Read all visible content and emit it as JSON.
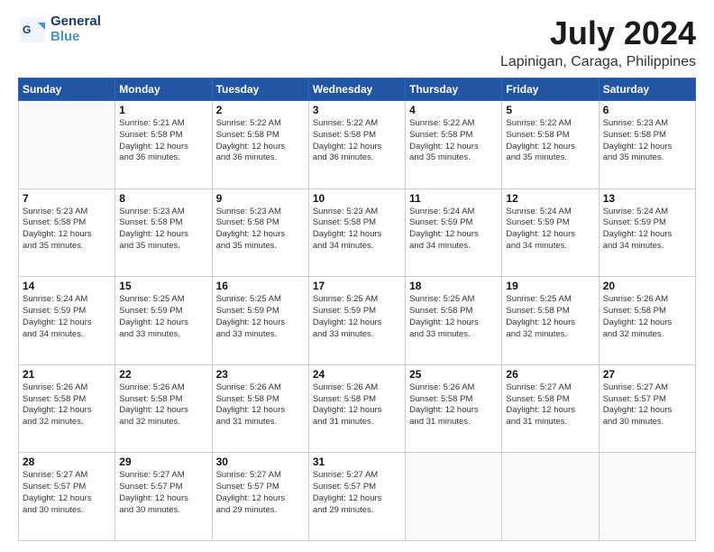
{
  "logo": {
    "line1": "General",
    "line2": "Blue"
  },
  "title": "July 2024",
  "subtitle": "Lapinigan, Caraga, Philippines",
  "days_of_week": [
    "Sunday",
    "Monday",
    "Tuesday",
    "Wednesday",
    "Thursday",
    "Friday",
    "Saturday"
  ],
  "weeks": [
    [
      {
        "num": "",
        "info": ""
      },
      {
        "num": "1",
        "info": "Sunrise: 5:21 AM\nSunset: 5:58 PM\nDaylight: 12 hours\nand 36 minutes."
      },
      {
        "num": "2",
        "info": "Sunrise: 5:22 AM\nSunset: 5:58 PM\nDaylight: 12 hours\nand 36 minutes."
      },
      {
        "num": "3",
        "info": "Sunrise: 5:22 AM\nSunset: 5:58 PM\nDaylight: 12 hours\nand 36 minutes."
      },
      {
        "num": "4",
        "info": "Sunrise: 5:22 AM\nSunset: 5:58 PM\nDaylight: 12 hours\nand 35 minutes."
      },
      {
        "num": "5",
        "info": "Sunrise: 5:22 AM\nSunset: 5:58 PM\nDaylight: 12 hours\nand 35 minutes."
      },
      {
        "num": "6",
        "info": "Sunrise: 5:23 AM\nSunset: 5:58 PM\nDaylight: 12 hours\nand 35 minutes."
      }
    ],
    [
      {
        "num": "7",
        "info": "Sunrise: 5:23 AM\nSunset: 5:58 PM\nDaylight: 12 hours\nand 35 minutes."
      },
      {
        "num": "8",
        "info": "Sunrise: 5:23 AM\nSunset: 5:58 PM\nDaylight: 12 hours\nand 35 minutes."
      },
      {
        "num": "9",
        "info": "Sunrise: 5:23 AM\nSunset: 5:58 PM\nDaylight: 12 hours\nand 35 minutes."
      },
      {
        "num": "10",
        "info": "Sunrise: 5:23 AM\nSunset: 5:58 PM\nDaylight: 12 hours\nand 34 minutes."
      },
      {
        "num": "11",
        "info": "Sunrise: 5:24 AM\nSunset: 5:59 PM\nDaylight: 12 hours\nand 34 minutes."
      },
      {
        "num": "12",
        "info": "Sunrise: 5:24 AM\nSunset: 5:59 PM\nDaylight: 12 hours\nand 34 minutes."
      },
      {
        "num": "13",
        "info": "Sunrise: 5:24 AM\nSunset: 5:59 PM\nDaylight: 12 hours\nand 34 minutes."
      }
    ],
    [
      {
        "num": "14",
        "info": "Sunrise: 5:24 AM\nSunset: 5:59 PM\nDaylight: 12 hours\nand 34 minutes."
      },
      {
        "num": "15",
        "info": "Sunrise: 5:25 AM\nSunset: 5:59 PM\nDaylight: 12 hours\nand 33 minutes."
      },
      {
        "num": "16",
        "info": "Sunrise: 5:25 AM\nSunset: 5:59 PM\nDaylight: 12 hours\nand 33 minutes."
      },
      {
        "num": "17",
        "info": "Sunrise: 5:25 AM\nSunset: 5:59 PM\nDaylight: 12 hours\nand 33 minutes."
      },
      {
        "num": "18",
        "info": "Sunrise: 5:25 AM\nSunset: 5:58 PM\nDaylight: 12 hours\nand 33 minutes."
      },
      {
        "num": "19",
        "info": "Sunrise: 5:25 AM\nSunset: 5:58 PM\nDaylight: 12 hours\nand 32 minutes."
      },
      {
        "num": "20",
        "info": "Sunrise: 5:26 AM\nSunset: 5:58 PM\nDaylight: 12 hours\nand 32 minutes."
      }
    ],
    [
      {
        "num": "21",
        "info": "Sunrise: 5:26 AM\nSunset: 5:58 PM\nDaylight: 12 hours\nand 32 minutes."
      },
      {
        "num": "22",
        "info": "Sunrise: 5:26 AM\nSunset: 5:58 PM\nDaylight: 12 hours\nand 32 minutes."
      },
      {
        "num": "23",
        "info": "Sunrise: 5:26 AM\nSunset: 5:58 PM\nDaylight: 12 hours\nand 31 minutes."
      },
      {
        "num": "24",
        "info": "Sunrise: 5:26 AM\nSunset: 5:58 PM\nDaylight: 12 hours\nand 31 minutes."
      },
      {
        "num": "25",
        "info": "Sunrise: 5:26 AM\nSunset: 5:58 PM\nDaylight: 12 hours\nand 31 minutes."
      },
      {
        "num": "26",
        "info": "Sunrise: 5:27 AM\nSunset: 5:58 PM\nDaylight: 12 hours\nand 31 minutes."
      },
      {
        "num": "27",
        "info": "Sunrise: 5:27 AM\nSunset: 5:57 PM\nDaylight: 12 hours\nand 30 minutes."
      }
    ],
    [
      {
        "num": "28",
        "info": "Sunrise: 5:27 AM\nSunset: 5:57 PM\nDaylight: 12 hours\nand 30 minutes."
      },
      {
        "num": "29",
        "info": "Sunrise: 5:27 AM\nSunset: 5:57 PM\nDaylight: 12 hours\nand 30 minutes."
      },
      {
        "num": "30",
        "info": "Sunrise: 5:27 AM\nSunset: 5:57 PM\nDaylight: 12 hours\nand 29 minutes."
      },
      {
        "num": "31",
        "info": "Sunrise: 5:27 AM\nSunset: 5:57 PM\nDaylight: 12 hours\nand 29 minutes."
      },
      {
        "num": "",
        "info": ""
      },
      {
        "num": "",
        "info": ""
      },
      {
        "num": "",
        "info": ""
      }
    ]
  ]
}
